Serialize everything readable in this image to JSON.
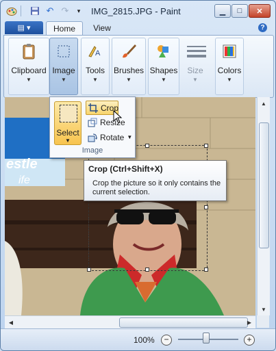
{
  "app": {
    "title": "IMG_2815.JPG - Paint",
    "window_buttons": {
      "minimize": "▁",
      "maximize": "□",
      "close": "✕"
    }
  },
  "tabs": [
    {
      "label": "Home",
      "active": true
    },
    {
      "label": "View",
      "active": false
    }
  ],
  "ribbon": {
    "groups": [
      {
        "label": "Clipboard",
        "icon": "clipboard-icon"
      },
      {
        "label": "Image",
        "icon": "image-select-icon",
        "pressed": true
      },
      {
        "label": "Tools",
        "icon": "tools-icon"
      },
      {
        "label": "Brushes",
        "icon": "brushes-icon"
      },
      {
        "label": "Shapes",
        "icon": "shapes-icon"
      },
      {
        "label": "Size",
        "icon": "size-icon",
        "disabled": true
      },
      {
        "label": "Colors",
        "icon": "colors-icon"
      }
    ]
  },
  "image_menu": {
    "select_label": "Select",
    "crop_label": "Crop",
    "resize_label": "Resize",
    "rotate_label": "Rotate",
    "group_title": "Image"
  },
  "tooltip": {
    "title": "Crop (Ctrl+Shift+X)",
    "body": "Crop the picture so it only contains the current selection."
  },
  "photo": {
    "sign_text": "estle",
    "sign_text_2": "ife"
  },
  "status": {
    "zoom": "100%",
    "zoom_out": "−",
    "zoom_in": "+",
    "zoom_level": 0.5
  },
  "colors": {
    "accent": "#1d4f9d",
    "highlight": "#f7c44f"
  }
}
